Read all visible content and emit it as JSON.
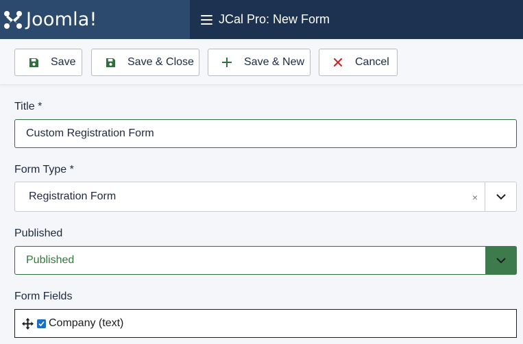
{
  "header": {
    "brand": "Joomla!",
    "page_title": "JCal Pro: New Form"
  },
  "toolbar": {
    "save_label": "Save",
    "save_close_label": "Save & Close",
    "save_new_label": "Save & New",
    "cancel_label": "Cancel"
  },
  "form": {
    "title_label": "Title *",
    "title_value": "Custom Registration Form",
    "form_type_label": "Form Type *",
    "form_type_value": "Registration Form",
    "form_type_clear": "×",
    "published_label": "Published",
    "published_value": "Published",
    "form_fields_label": "Form Fields",
    "form_fields_items": [
      {
        "label": "Company (text)",
        "checked": true
      }
    ]
  },
  "colors": {
    "header_logo_bg": "#2c4a6e",
    "header_title_bg": "#1c3250",
    "success_green": "#3d7a4c",
    "danger_red": "#c52827",
    "checkbox_blue": "#1b6ec2"
  },
  "icons": {
    "save": "floppy-disk-icon",
    "add": "plus-icon",
    "cancel": "x-icon",
    "menu": "hamburger-icon",
    "move": "move-arrows-icon"
  }
}
